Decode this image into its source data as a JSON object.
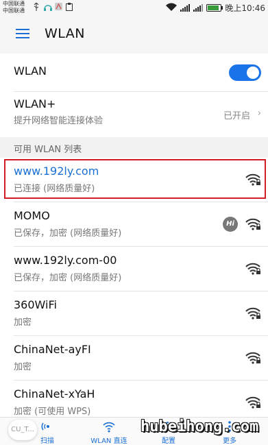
{
  "status_bar": {
    "carrier_1": "中国联通",
    "carrier_2": "中国联通",
    "time": "晚上10:46",
    "battery_level": 0.85
  },
  "app_bar": {
    "title": "WLAN",
    "menu_icon": "menu-icon"
  },
  "wlan_toggle": {
    "label": "WLAN",
    "on": true
  },
  "wlan_plus": {
    "title": "WLAN+",
    "subtitle": "提升网络智能连接体验",
    "value": "已开启",
    "chevron": "›"
  },
  "list_header": "可用 WLAN 列表",
  "networks": [
    {
      "name": "www.192ly.com",
      "status": "已连接 (网络质量好)",
      "locked": true,
      "active": true
    },
    {
      "name": "MOMO",
      "status": "已保存，加密 (网络质量好)",
      "locked": true,
      "badge": "Hi"
    },
    {
      "name": "www.192ly.com-00",
      "status": "已保存，加密 (网络质量好)",
      "locked": true
    },
    {
      "name": "360WiFi",
      "status": "加密",
      "locked": true
    },
    {
      "name": "ChinaNet-ayFI",
      "status": "加密",
      "locked": true
    },
    {
      "name": "ChinaNet-xYaH",
      "status": "加密 (可使用 WPS)",
      "locked": true
    }
  ],
  "bottom_bar": {
    "tabs": [
      {
        "label": "扫描",
        "icon": "scan-icon"
      },
      {
        "label": "WLAN 直连",
        "icon": "wifi-direct-icon"
      },
      {
        "label": "配置",
        "icon": "settings-icon"
      },
      {
        "label": "更多",
        "icon": "more-icon"
      }
    ],
    "fab_label": "CU_T..."
  },
  "watermark": "hubeihong.com",
  "colors": {
    "accent": "#1a73e8",
    "highlight_border": "#d01c24"
  }
}
